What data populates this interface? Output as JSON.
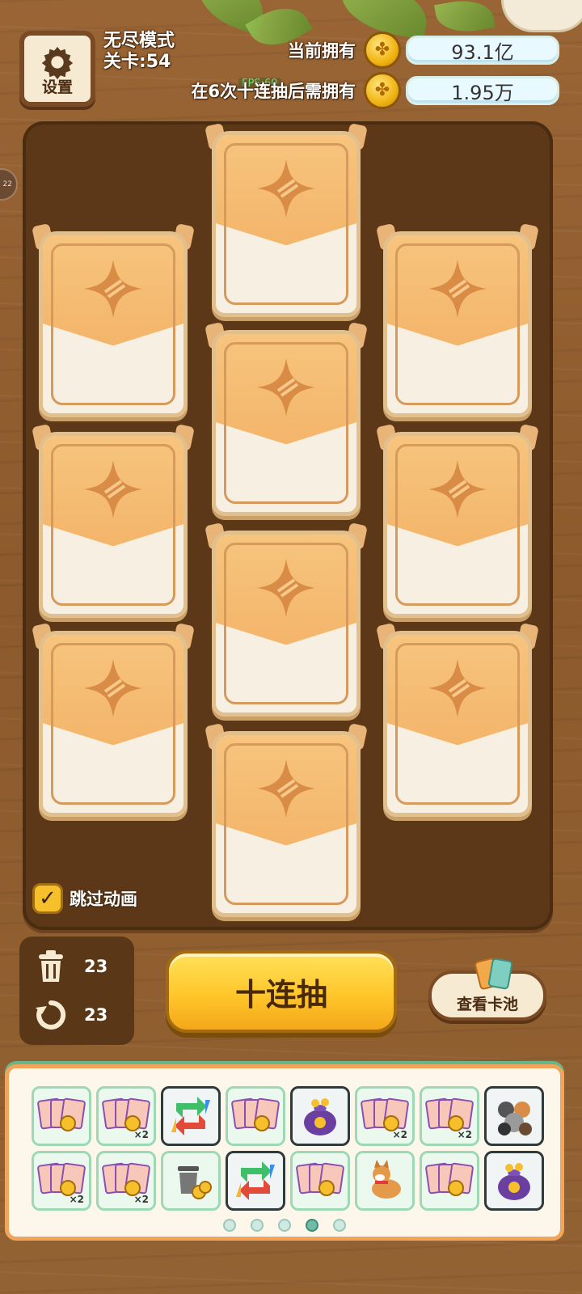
{
  "header": {
    "settings_label": "设置",
    "mode_title": "无尽模式",
    "level_text": "关卡:54",
    "current_owned_label": "当前拥有",
    "current_owned_value": "93.1亿",
    "required_label": "在6次十连抽后需拥有",
    "required_value": "1.95万",
    "fps_text": "FPS:60",
    "side_tab_text": "22"
  },
  "board": {
    "card_count": 10,
    "skip_animation_label": "跳过动画",
    "skip_animation_checked": true
  },
  "controls": {
    "trash_count": "23",
    "refresh_count": "23",
    "draw_ten_label": "十连抽",
    "view_pool_label": "查看卡池"
  },
  "rewards": {
    "row1": [
      "card-pack",
      "card-pack-x2",
      "swap",
      "card-pack",
      "coin-bag",
      "card-pack-x2",
      "card-pack-x2",
      "pet-group"
    ],
    "row2": [
      "card-pack-x2",
      "card-pack-x2",
      "trash-coins",
      "swap",
      "card-pack",
      "shiba-dog",
      "card-pack",
      "coin-bag"
    ],
    "x2_label": "×2",
    "pages": 5,
    "active_page": 4
  },
  "colors": {
    "wood": "#8b5a2b",
    "board": "#5c3818",
    "card_top": "#f3b56a",
    "draw_button": "#ffc62a",
    "stat_box": "#e8f9ff"
  }
}
